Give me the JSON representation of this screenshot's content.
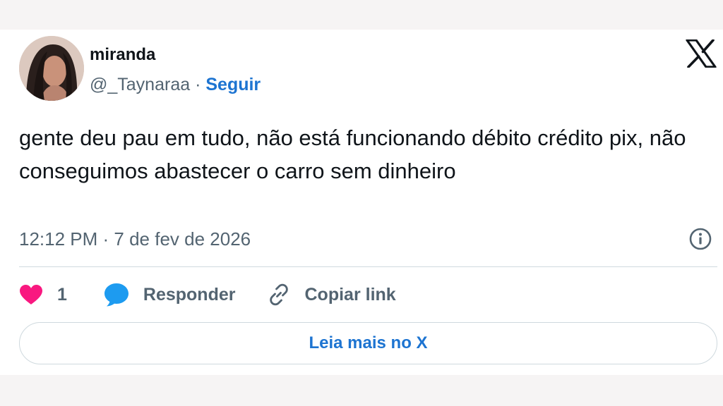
{
  "author": {
    "display_name": "miranda",
    "handle": "@_Taynaraa",
    "separator": " · ",
    "follow_label": "Seguir"
  },
  "brand": {
    "logo_icon": "x-logo-icon"
  },
  "tweet": {
    "text": "gente deu pau em tudo, não está funcionando débito crédito pix, não conseguimos abastecer o carro sem dinheiro",
    "time": "12:12 PM",
    "date_separator": " · ",
    "date": "7 de fev de 2026"
  },
  "actions": {
    "like_icon": "heart-icon",
    "like_count": "1",
    "reply_icon": "speech-bubble-icon",
    "reply_label": "Responder",
    "copy_icon": "link-icon",
    "copy_label": "Copiar link"
  },
  "read_more": {
    "label": "Leia mais no X"
  },
  "colors": {
    "text_primary": "#0f1419",
    "text_secondary": "#536471",
    "link_blue": "#1d74d1",
    "like_pink": "#f91880",
    "reply_blue": "#1d9bf0",
    "border": "#cfd9de"
  }
}
